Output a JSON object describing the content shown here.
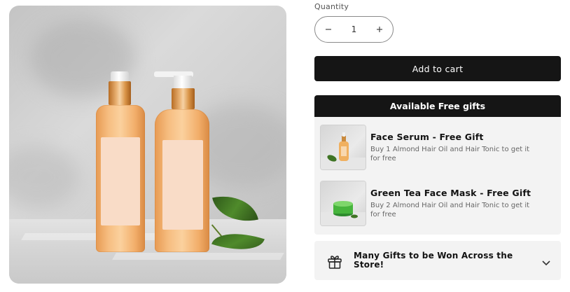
{
  "product": {
    "image_alt": "Two amber pump bottles with blank labels beside a green leaf"
  },
  "quantity": {
    "label": "Quantity",
    "value": "1",
    "decrement_icon": "minus-icon",
    "increment_icon": "plus-icon"
  },
  "cart": {
    "add_label": "Add to cart"
  },
  "free_gifts": {
    "header": "Available Free gifts",
    "items": [
      {
        "title": "Face Serum - Free Gift",
        "description": "Buy 1 Almond Hair Oil and Hair Tonic to get it for free",
        "thumb": "serum-bottle"
      },
      {
        "title": "Green Tea Face Mask - Free Gift",
        "description": "Buy 2 Almond Hair Oil and Hair Tonic to get it for free",
        "thumb": "mask-jar"
      }
    ]
  },
  "promo": {
    "text": "Many Gifts to be Won Across the Store!",
    "icon": "gift-icon",
    "chevron": "chevron-down-icon"
  },
  "colors": {
    "button_bg": "#151515",
    "panel_bg": "#f3f3f3",
    "bottle_amber": "#f2ae6a",
    "leaf_green": "#3f7424"
  }
}
